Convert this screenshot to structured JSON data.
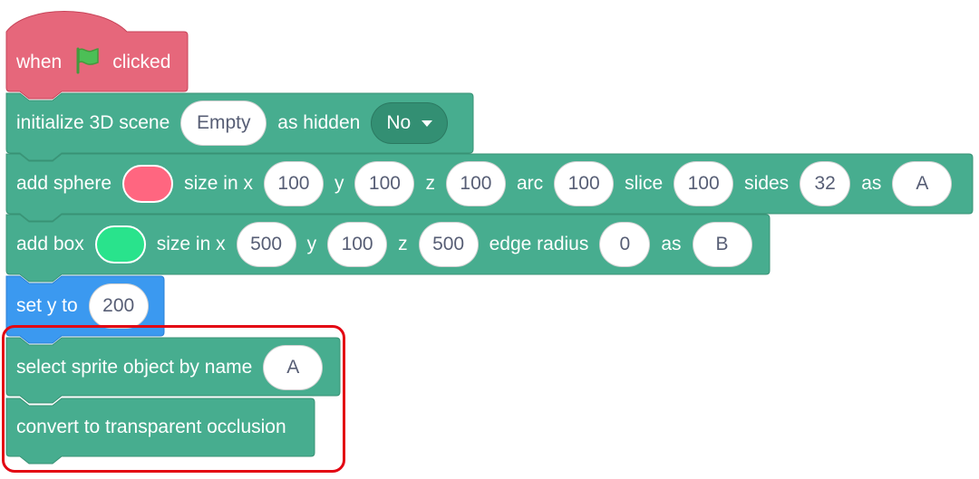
{
  "colors": {
    "event_block": "#e6677b",
    "event_border": "#c74358",
    "extension_block": "#47ad8f",
    "extension_border": "#389275",
    "motion_block": "#3b99f0",
    "motion_border": "#2a7fd6",
    "pill_text": "#575e75",
    "highlight": "#e30613"
  },
  "hat_block": {
    "when_label": "when",
    "flag_icon": "green-flag-icon",
    "clicked_label": "clicked"
  },
  "init_block": {
    "label": "initialize 3D scene",
    "scene_value": "Empty",
    "as_hidden_label": "as hidden",
    "hidden_value": "No"
  },
  "sphere_block": {
    "label": "add sphere",
    "color": "#ff6680",
    "size_label": "size in x",
    "x": "100",
    "y_label": "y",
    "y": "100",
    "z_label": "z",
    "z": "100",
    "arc_label": "arc",
    "arc": "100",
    "slice_label": "slice",
    "slice": "100",
    "sides_label": "sides",
    "sides": "32",
    "as_label": "as",
    "name": "A"
  },
  "box_block": {
    "label": "add box",
    "color": "#29e38c",
    "size_label": "size in x",
    "x": "500",
    "y_label": "y",
    "y": "100",
    "z_label": "z",
    "z": "500",
    "edge_label": "edge radius",
    "edge": "0",
    "as_label": "as",
    "name": "B"
  },
  "sety_block": {
    "label": "set y to",
    "value": "200"
  },
  "select_block": {
    "label": "select sprite object by name",
    "value": "A"
  },
  "convert_block": {
    "label": "convert to transparent occlusion"
  }
}
